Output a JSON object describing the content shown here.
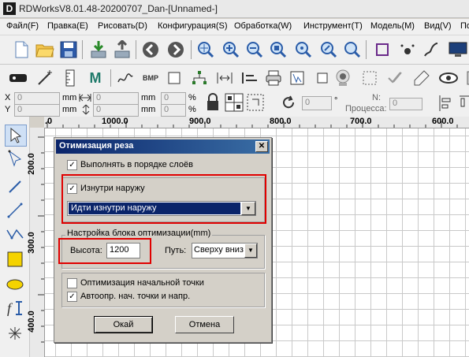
{
  "window": {
    "title": "RDWorksV8.01.48-20200707_Dan-[Unnamed-]",
    "logo": "D"
  },
  "menu": [
    "Файл(F)",
    "Правка(E)",
    "Рисовать(D)",
    "Конфигурация(S)",
    "Обработка(W)",
    "Инструмент(T)",
    "Модель(M)",
    "Вид(V)",
    "По"
  ],
  "toolbar_icons": [
    "new-file-icon",
    "open-folder-icon",
    "save-icon",
    "import-icon",
    "export-icon",
    "back-icon",
    "forward-icon",
    "zoom-pan-icon",
    "zoom-in-icon",
    "zoom-out-icon",
    "zoom-page-icon",
    "zoom-select-icon",
    "zoom-fit-icon",
    "frame-icon",
    "spot-icon",
    "path-icon",
    "monitor-icon"
  ],
  "coords": {
    "x_label": "X",
    "y_label": "Y",
    "x_value": "0",
    "y_value": "0",
    "unit": "mm",
    "w_value": "0",
    "h_value": "0",
    "pct": "%",
    "rotate_value": "0",
    "deg": "°",
    "processes_label_1": "N:",
    "processes_label_2": "Процесса:",
    "processes_value": "0"
  },
  "ruler": {
    "h_labels": [
      ".0",
      "1000.0",
      "900.0",
      "800.0",
      "700.0",
      "600.0"
    ],
    "v_labels": [
      "200.0",
      "300.0",
      "400.0"
    ]
  },
  "dialog": {
    "title": "Отимизация реза",
    "close": "✕",
    "layer_order": {
      "label": "Выполнять в порядке слоёв",
      "checked": true
    },
    "inside_out": {
      "label": "Изнутри наружу",
      "checked": true
    },
    "inside_out_select": "Идти изнутри наружу",
    "block_group": {
      "title": "Настройка блока оптимизации(mm)",
      "height_label": "Высота:",
      "height_value": "1200",
      "path_label": "Путь:",
      "path_value": "Сверху вниз"
    },
    "start_point_opt": {
      "label": "Оптимизация начальной точки",
      "checked": false
    },
    "auto_start": {
      "label": "Автоопр. нач. точки и напр.",
      "checked": true
    },
    "ok": "Окай",
    "cancel": "Отмена",
    "check_mark": "✓",
    "dropdown_arrow": "▼",
    "highlight_color": "#e00000"
  }
}
